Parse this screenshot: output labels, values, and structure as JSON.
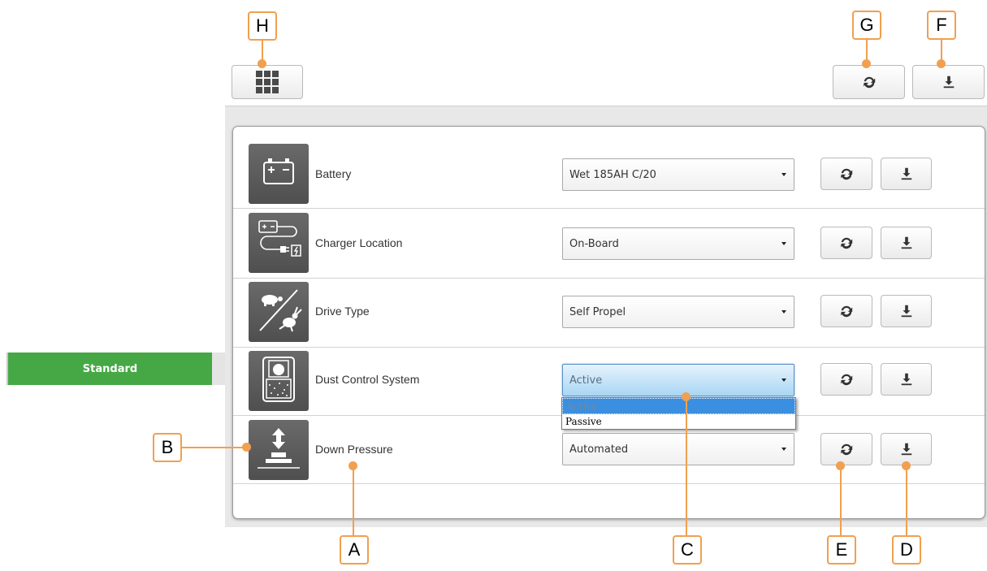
{
  "toolbar": {
    "grid_icon": "grid-icon",
    "refresh_all_icon": "refresh-icon",
    "download_all_icon": "download-icon"
  },
  "sidebar": {
    "standard_label": "Standard"
  },
  "rows": [
    {
      "label": "Battery",
      "value": "Wet 185AH C/20",
      "icon": "battery-icon"
    },
    {
      "label": "Charger Location",
      "value": "On-Board",
      "icon": "charger-icon"
    },
    {
      "label": "Drive Type",
      "value": "Self Propel",
      "icon": "turtle-rabbit-icon"
    },
    {
      "label": "Dust Control System",
      "value": "Active",
      "icon": "dust-control-icon"
    },
    {
      "label": "Down Pressure",
      "value": "Automated",
      "icon": "down-pressure-icon"
    }
  ],
  "dropdown": {
    "options": [
      "Active",
      "Passive"
    ],
    "selected": "Active"
  },
  "callouts": {
    "a": "A",
    "b": "B",
    "c": "C",
    "d": "D",
    "e": "E",
    "f": "F",
    "g": "G",
    "h": "H"
  },
  "colors": {
    "accent": "#f0a050",
    "standard": "#45a845",
    "tile": "#5a5a5a"
  }
}
